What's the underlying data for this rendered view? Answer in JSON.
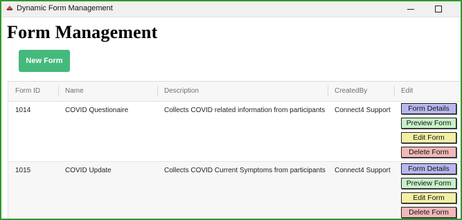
{
  "window": {
    "title": "Dynamic Form Management"
  },
  "page": {
    "title": "Form Management",
    "new_form_label": "New Form"
  },
  "table": {
    "headers": [
      "Form ID",
      "Name",
      "Description",
      "CreatedBy",
      "Edit"
    ],
    "rows": [
      {
        "id": "1014",
        "name": "COVID Questionaire",
        "description": "Collects COVID related information from participants",
        "created_by": "Connect4 Support"
      },
      {
        "id": "1015",
        "name": "COVID Update",
        "description": "Collects COVID Current Symptoms from participants",
        "created_by": "Connect4 Support"
      }
    ],
    "actions": {
      "details": "Form Details",
      "preview": "Preview Form",
      "edit": "Edit Form",
      "delete": "Delete Form"
    }
  },
  "colors": {
    "accent": "#45b97c",
    "details": "#b7b7ee",
    "preview": "#c9f1c9",
    "edit": "#f3f0a5",
    "delete": "#f1b9b9",
    "window_border": "#2e9a2e"
  },
  "icons": {
    "app": "app-icon",
    "minimize": "minimize-icon",
    "maximize": "maximize-icon"
  }
}
